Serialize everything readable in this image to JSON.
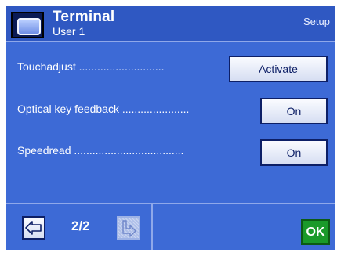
{
  "header": {
    "title": "Terminal",
    "user": "User 1",
    "mode": "Setup",
    "icon": "terminal-display-icon"
  },
  "settings": [
    {
      "label": "Touchadjust ............................",
      "value": "Activate"
    },
    {
      "label": "Optical key feedback ......................",
      "value": "On"
    },
    {
      "label": "Speedread ....................................",
      "value": "On"
    }
  ],
  "footer": {
    "page": "2/2",
    "back_icon": "arrow-left-icon",
    "forward_icon": "arrow-return-icon",
    "ok_label": "OK"
  },
  "colors": {
    "background": "#3d6ad6",
    "header": "#2f58c2",
    "ok_button": "#1a9a2a"
  }
}
